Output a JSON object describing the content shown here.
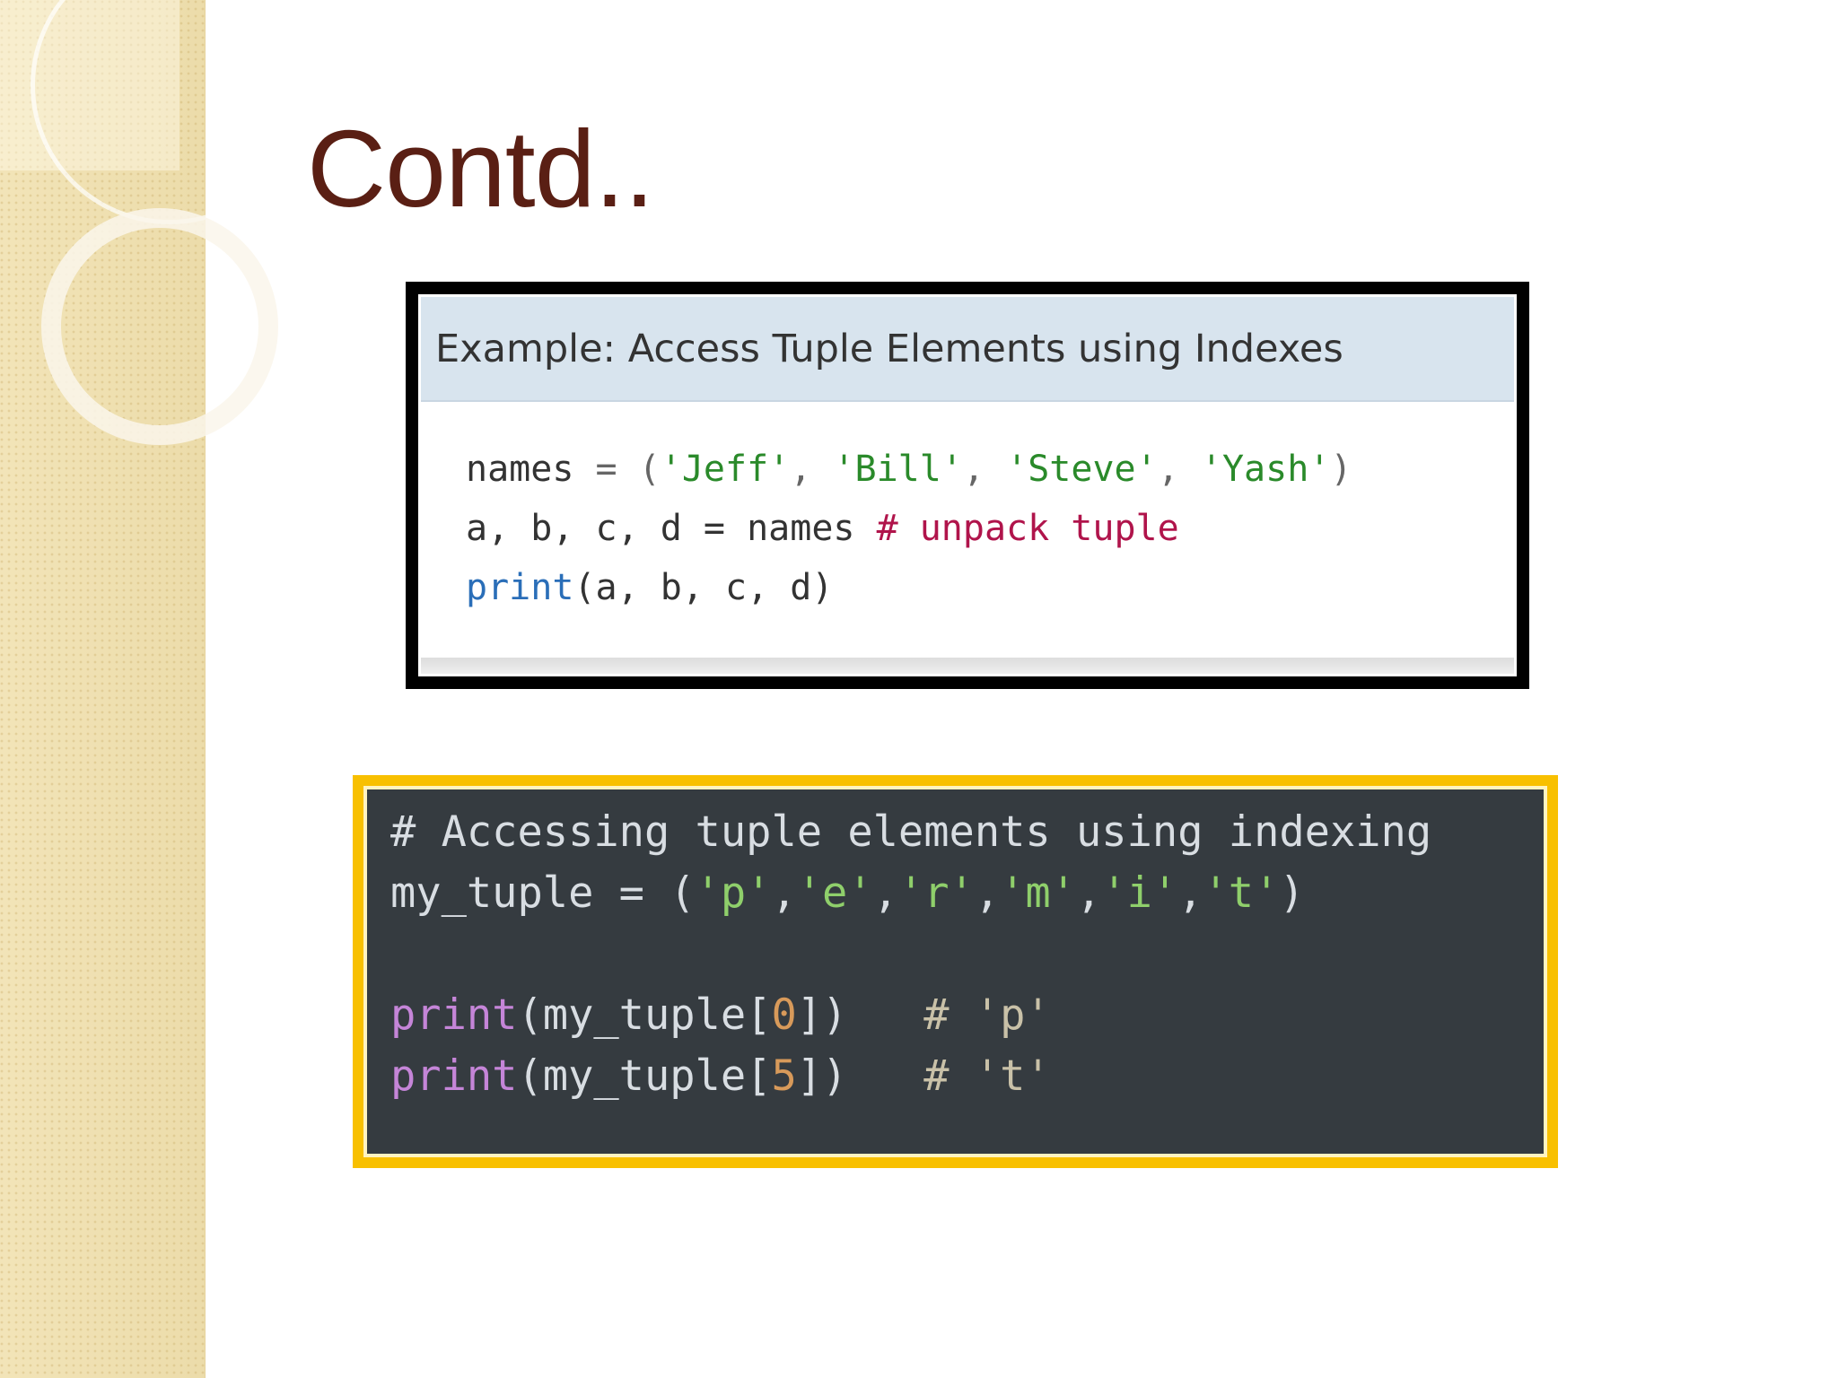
{
  "slide": {
    "title": "Contd.."
  },
  "example_box": {
    "header": "Example: Access Tuple Elements using Indexes",
    "lines": [
      {
        "var": "names",
        "op": " = ",
        "paren_open": "(",
        "items": [
          "'Jeff'",
          "'Bill'",
          "'Steve'",
          "'Yash'"
        ],
        "sep": ", ",
        "paren_close": ")"
      },
      {
        "code": "a, b, c, d = names ",
        "comment": "# unpack tuple"
      },
      {
        "func": "print",
        "args": "(a, b, c, d)"
      }
    ]
  },
  "dark_box": {
    "line1": "# Accessing tuple elements using indexing",
    "line2_var": "my_tuple = (",
    "line2_items": [
      "'p'",
      "'e'",
      "'r'",
      "'m'",
      "'i'",
      "'t'"
    ],
    "line2_close": ")",
    "line4": {
      "func": "print",
      "pre": "(my_tuple[",
      "idx": "0",
      "post": "])   ",
      "comment": "# 'p'"
    },
    "line5": {
      "func": "print",
      "pre": "(my_tuple[",
      "idx": "5",
      "post": "])   ",
      "comment": "# 't'"
    }
  },
  "colors": {
    "title": "#5a1f14",
    "frame_gold": "#f8c000",
    "dark_bg": "#353b40",
    "header_bg": "#d8e4ee"
  }
}
